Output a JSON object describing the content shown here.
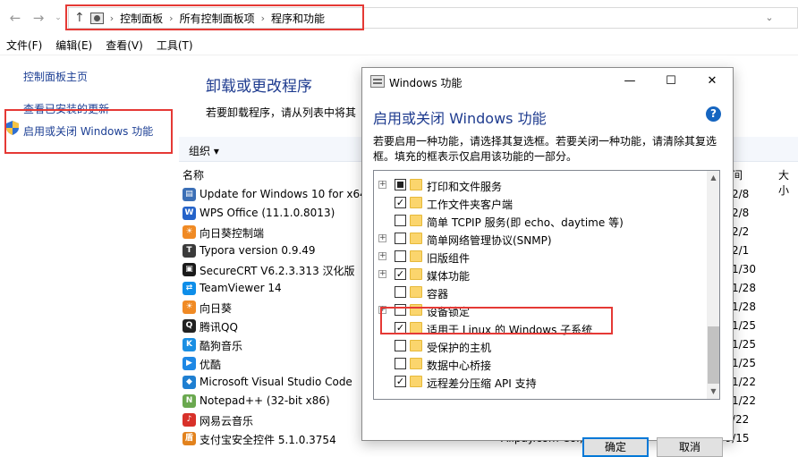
{
  "address_bar": {
    "back_icon": "back-arrow",
    "forward_icon": "forward-arrow",
    "recent_icon": "chevron-down",
    "up_icon": "up-arrow",
    "crumbs": [
      "控制面板",
      "所有控制面板项",
      "程序和功能"
    ],
    "refresh_icon": "chevron-down"
  },
  "menubar": {
    "items": [
      "文件(F)",
      "编辑(E)",
      "查看(V)",
      "工具(T)"
    ]
  },
  "left_panel": {
    "home_link": "控制面板主页",
    "updates_link": "查看已安装的更新",
    "features_link": "启用或关闭 Windows 功能"
  },
  "main": {
    "title": "卸载或更改程序",
    "description": "若要卸载程序，请从列表中将其",
    "organize": "组织 ▾",
    "columns": {
      "name": "名称",
      "time": "间",
      "size": "大小"
    },
    "programs": [
      {
        "name": "Update for Windows 10 for x64",
        "date": "2/8",
        "color": "#3b6fb6",
        "glyph": "▤"
      },
      {
        "name": "WPS Office (11.1.0.8013)",
        "date": "2/8",
        "color": "#2563c9",
        "glyph": "W"
      },
      {
        "name": "向日葵控制端",
        "date": "2/2",
        "color": "#f08a24",
        "glyph": "☀"
      },
      {
        "name": "Typora version 0.9.49",
        "date": "2/1",
        "color": "#3a3a3a",
        "glyph": "T"
      },
      {
        "name": "SecureCRT V6.2.3.313 汉化版",
        "date": "1/30",
        "color": "#1a1a1a",
        "glyph": "▣"
      },
      {
        "name": "TeamViewer 14",
        "date": "1/28",
        "color": "#0e8ee9",
        "glyph": "⇄"
      },
      {
        "name": "向日葵",
        "date": "1/28",
        "color": "#f08a24",
        "glyph": "☀"
      },
      {
        "name": "腾讯QQ",
        "date": "1/25",
        "color": "#222222",
        "glyph": "Q"
      },
      {
        "name": "酷狗音乐",
        "date": "1/25",
        "color": "#1a8fe3",
        "glyph": "K"
      },
      {
        "name": "优酷",
        "date": "1/25",
        "color": "#1e88e5",
        "glyph": "▶"
      },
      {
        "name": "Microsoft Visual Studio Code",
        "date": "1/22",
        "color": "#1f7fd1",
        "glyph": "◆"
      },
      {
        "name": "Notepad++ (32-bit x86)",
        "date": "1/22",
        "color": "#6aa84f",
        "glyph": "N"
      },
      {
        "name": "网易云音乐",
        "date": "/22",
        "color": "#d8312a",
        "glyph": "♪"
      },
      {
        "name": "支付宝安全控件 5.1.0.3754",
        "date": "2019/9/15",
        "color": "#e2821d",
        "glyph": "盾",
        "publisher": "Alipay.com Co., Ltd."
      }
    ]
  },
  "dialog": {
    "title": "Windows 功能",
    "heading": "启用或关闭 Windows 功能",
    "description": "若要启用一种功能，请选择其复选框。若要关闭一种功能，请清除其复选框。填充的框表示仅启用该功能的一部分。",
    "features": [
      {
        "label": "打印和文件服务",
        "expandable": true,
        "state": "partial"
      },
      {
        "label": "工作文件夹客户端",
        "expandable": false,
        "state": "checked"
      },
      {
        "label": "简单 TCPIP 服务(即 echo、daytime 等)",
        "expandable": false,
        "state": "unchecked"
      },
      {
        "label": "简单网络管理协议(SNMP)",
        "expandable": true,
        "state": "unchecked"
      },
      {
        "label": "旧版组件",
        "expandable": true,
        "state": "unchecked"
      },
      {
        "label": "媒体功能",
        "expandable": true,
        "state": "checked"
      },
      {
        "label": "容器",
        "expandable": false,
        "state": "unchecked"
      },
      {
        "label": "设备锁定",
        "expandable": true,
        "state": "unchecked"
      },
      {
        "label": "适用于 Linux 的 Windows 子系统",
        "expandable": false,
        "state": "checked"
      },
      {
        "label": "受保护的主机",
        "expandable": false,
        "state": "unchecked"
      },
      {
        "label": "数据中心桥接",
        "expandable": false,
        "state": "unchecked"
      },
      {
        "label": "远程差分压缩 API 支持",
        "expandable": false,
        "state": "checked"
      }
    ],
    "ok_label": "确定",
    "cancel_label": "取消",
    "help_glyph": "?",
    "minimize_glyph": "—",
    "maximize_glyph": "☐",
    "close_glyph": "✕"
  },
  "colors": {
    "link": "#1c3f94",
    "heading": "#1e3b8f",
    "highlight_box": "#e53935",
    "toolbar": "#f4f7fc"
  }
}
